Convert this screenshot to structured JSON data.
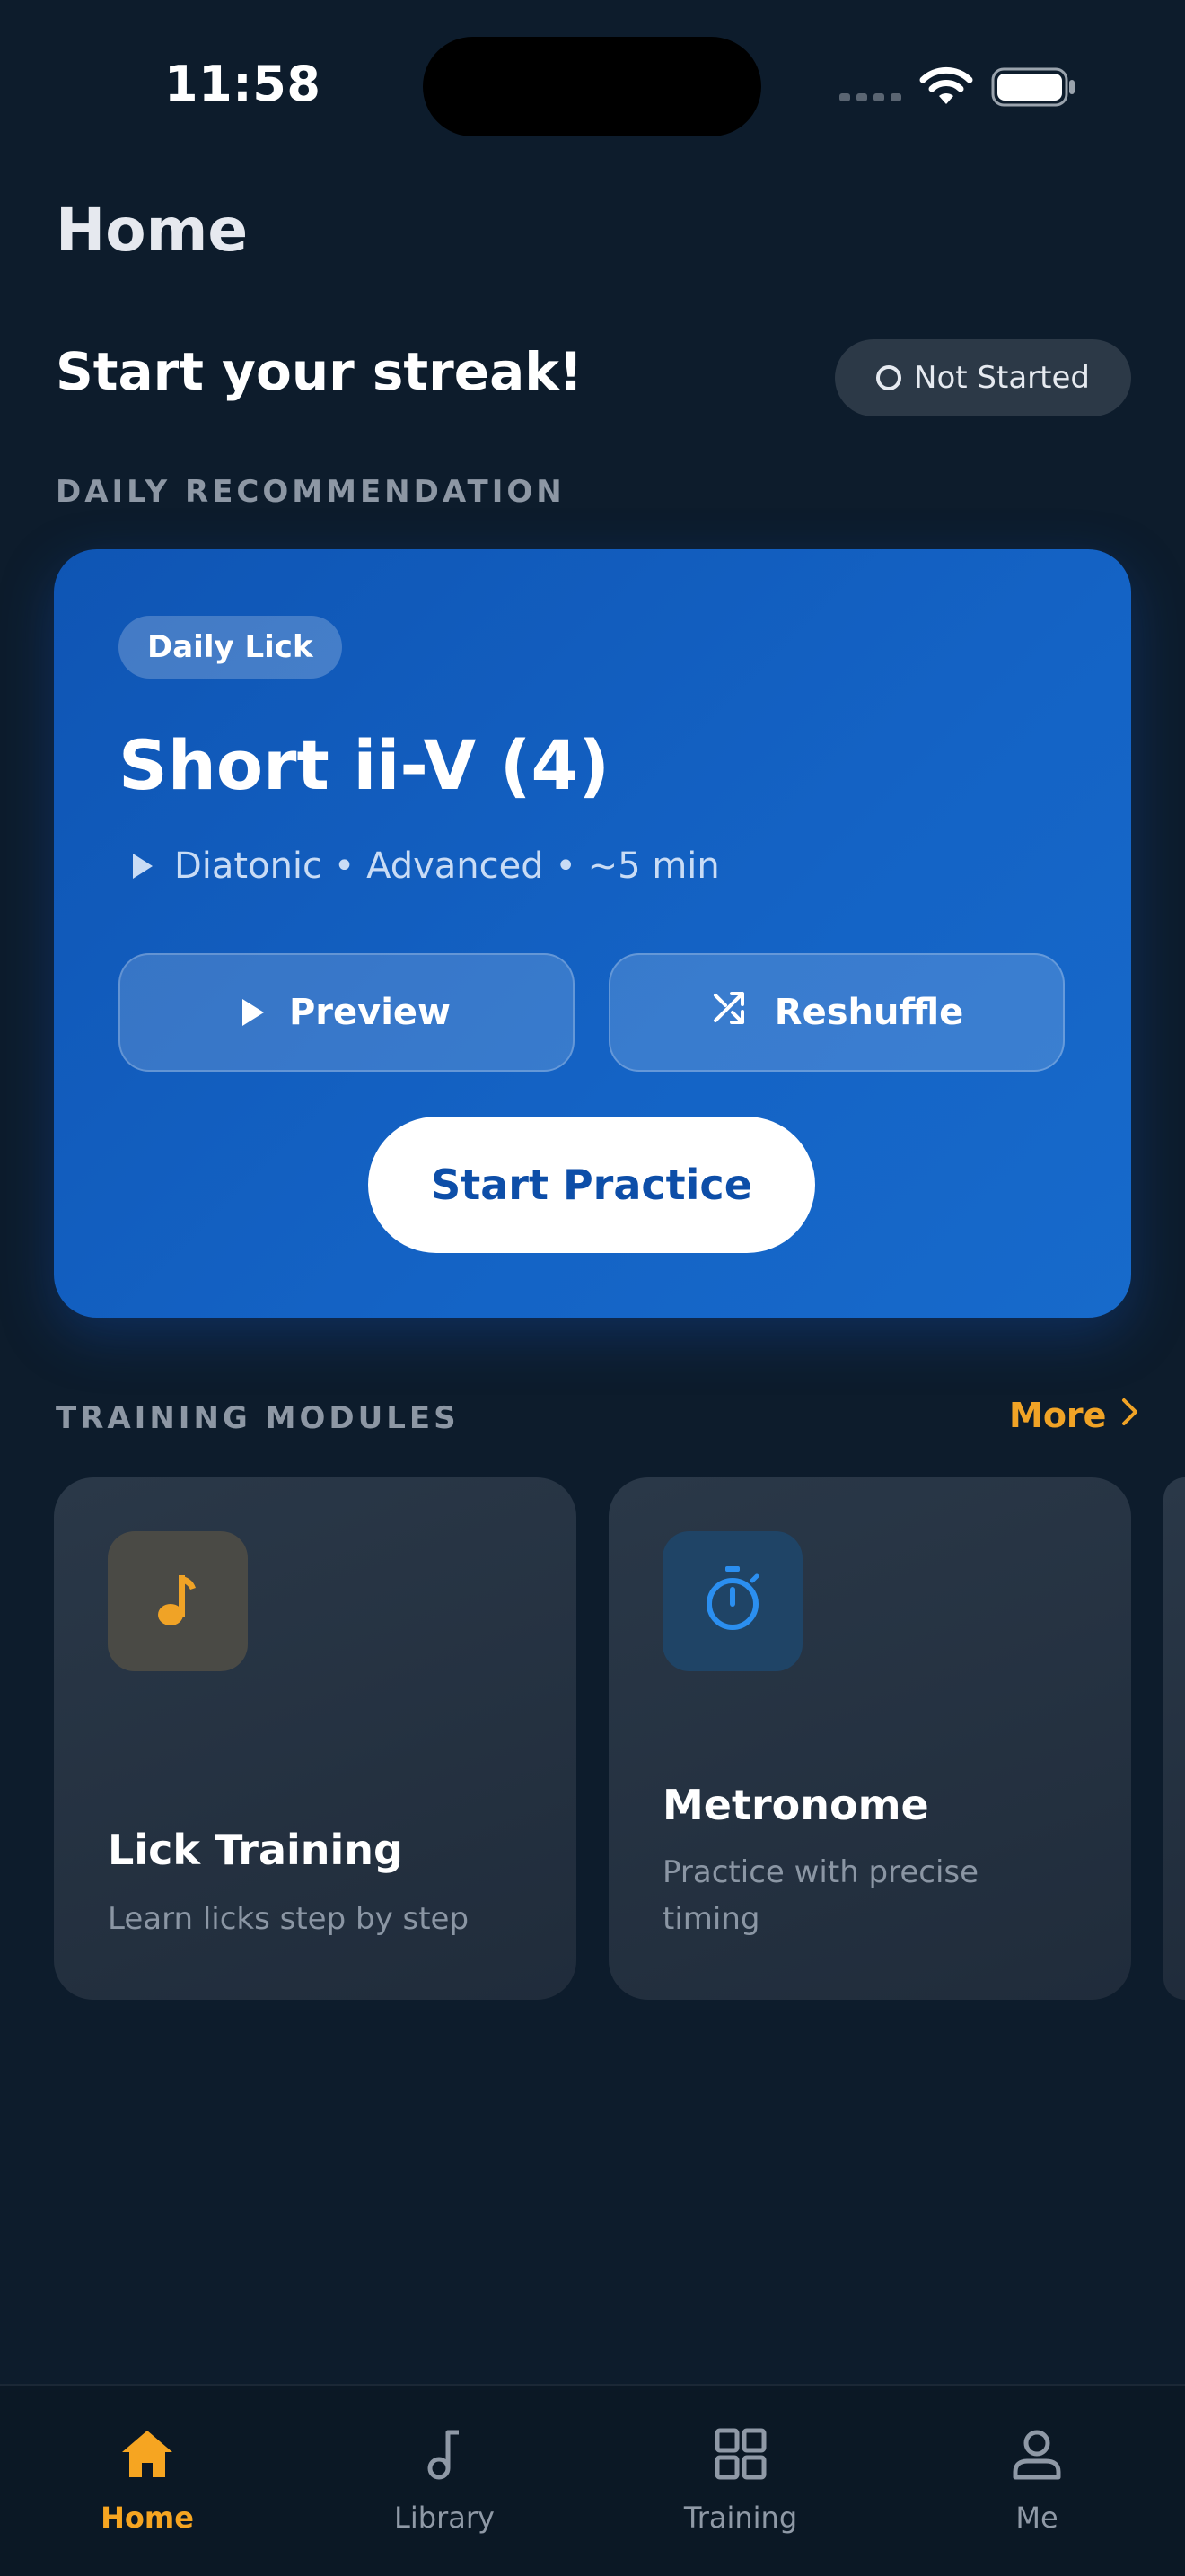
{
  "status_bar": {
    "time": "11:58"
  },
  "header": {
    "title": "Home"
  },
  "streak": {
    "title": "Start your streak!",
    "badge": "Not Started"
  },
  "daily": {
    "section_label": "DAILY RECOMMENDATION",
    "tag": "Daily Lick",
    "title": "Short ii-V (4)",
    "meta": "Diatonic • Advanced • ~5 min",
    "preview_label": "Preview",
    "reshuffle_label": "Reshuffle",
    "start_label": "Start Practice"
  },
  "training": {
    "section_label": "TRAINING MODULES",
    "more_label": "More",
    "modules": [
      {
        "title": "Lick Training",
        "desc": "Learn licks step by step",
        "icon": "music-note-icon",
        "accent": "#f0a326"
      },
      {
        "title": "Metronome",
        "desc": "Practice with precise timing",
        "icon": "stopwatch-icon",
        "accent": "#2b8ff0"
      }
    ]
  },
  "tab_bar": {
    "items": [
      {
        "label": "Home",
        "icon": "home-icon",
        "active": true
      },
      {
        "label": "Library",
        "icon": "music-note-icon",
        "active": false
      },
      {
        "label": "Training",
        "icon": "grid-icon",
        "active": false
      },
      {
        "label": "Me",
        "icon": "person-icon",
        "active": false
      }
    ]
  },
  "colors": {
    "background": "#0d1c2c",
    "accent": "#f6a521",
    "card_blue": "#1463c5"
  }
}
